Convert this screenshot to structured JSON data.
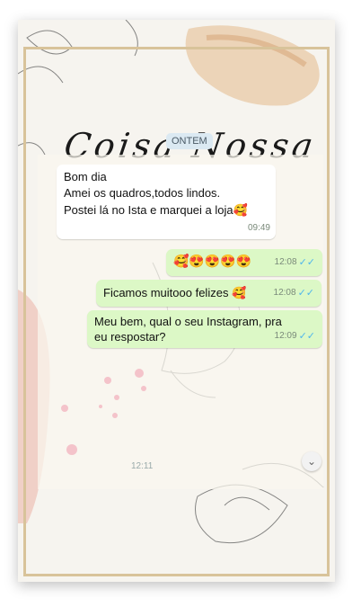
{
  "header": {
    "title": "Coisa Nossa"
  },
  "date_chip": "ONTEM",
  "messages": [
    {
      "direction": "in",
      "lines": [
        "Bom dia",
        "Amei os quadros,todos lindos.",
        "Postei lá no Ista e marquei a loja🥰"
      ],
      "time": "09:49"
    },
    {
      "direction": "out",
      "text": "🥰😍😍😍😍",
      "time": "12:08",
      "status": "read"
    },
    {
      "direction": "out",
      "text": "Ficamos muitooo felizes 🥰",
      "time": "12:08",
      "status": "read"
    },
    {
      "direction": "out",
      "lines": [
        "Meu bem, qual o seu Instagram, pra",
        "eu respostar?"
      ],
      "time": "12:09",
      "status": "read"
    }
  ],
  "peek_time": "12:11",
  "icons": {
    "read_ticks": "double-check-icon",
    "scroll": "double-chevron-down-icon"
  },
  "colors": {
    "incoming": "#ffffff",
    "outgoing": "#dcf8c6",
    "ticks": "#4fb6ec",
    "frame": "#d8c39a"
  }
}
